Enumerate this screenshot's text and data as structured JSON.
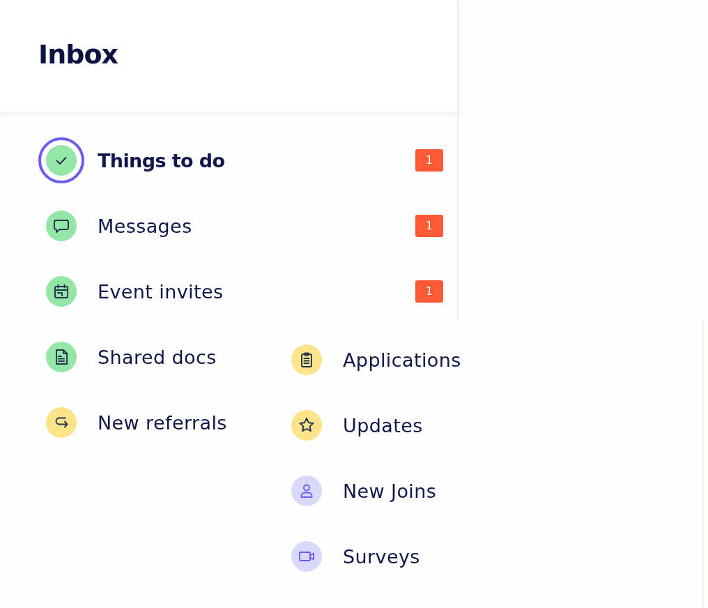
{
  "header": {
    "title": "Inbox"
  },
  "items": [
    {
      "label": "Things to do",
      "selected": true,
      "color": "#93e6a6",
      "badge": "1"
    },
    {
      "label": "Messages",
      "selected": false,
      "color": "#93e6a6",
      "badge": "1"
    },
    {
      "label": "Event invites",
      "selected": false,
      "color": "#93e6a6",
      "badge": "1"
    },
    {
      "label": "Shared docs",
      "selected": false,
      "color": "#93e6a6"
    },
    {
      "label": "New referrals",
      "selected": false,
      "color": "#fde38a"
    }
  ],
  "more_items": [
    {
      "label": "Applications",
      "selected": false,
      "color": "#fde38a"
    },
    {
      "label": "Updates",
      "selected": false,
      "color": "#fde38a"
    },
    {
      "label": "New Joins",
      "selected": false,
      "color": "#dad9fd"
    },
    {
      "label": "Surveys",
      "selected": false,
      "color": "#dad9fd"
    }
  ]
}
